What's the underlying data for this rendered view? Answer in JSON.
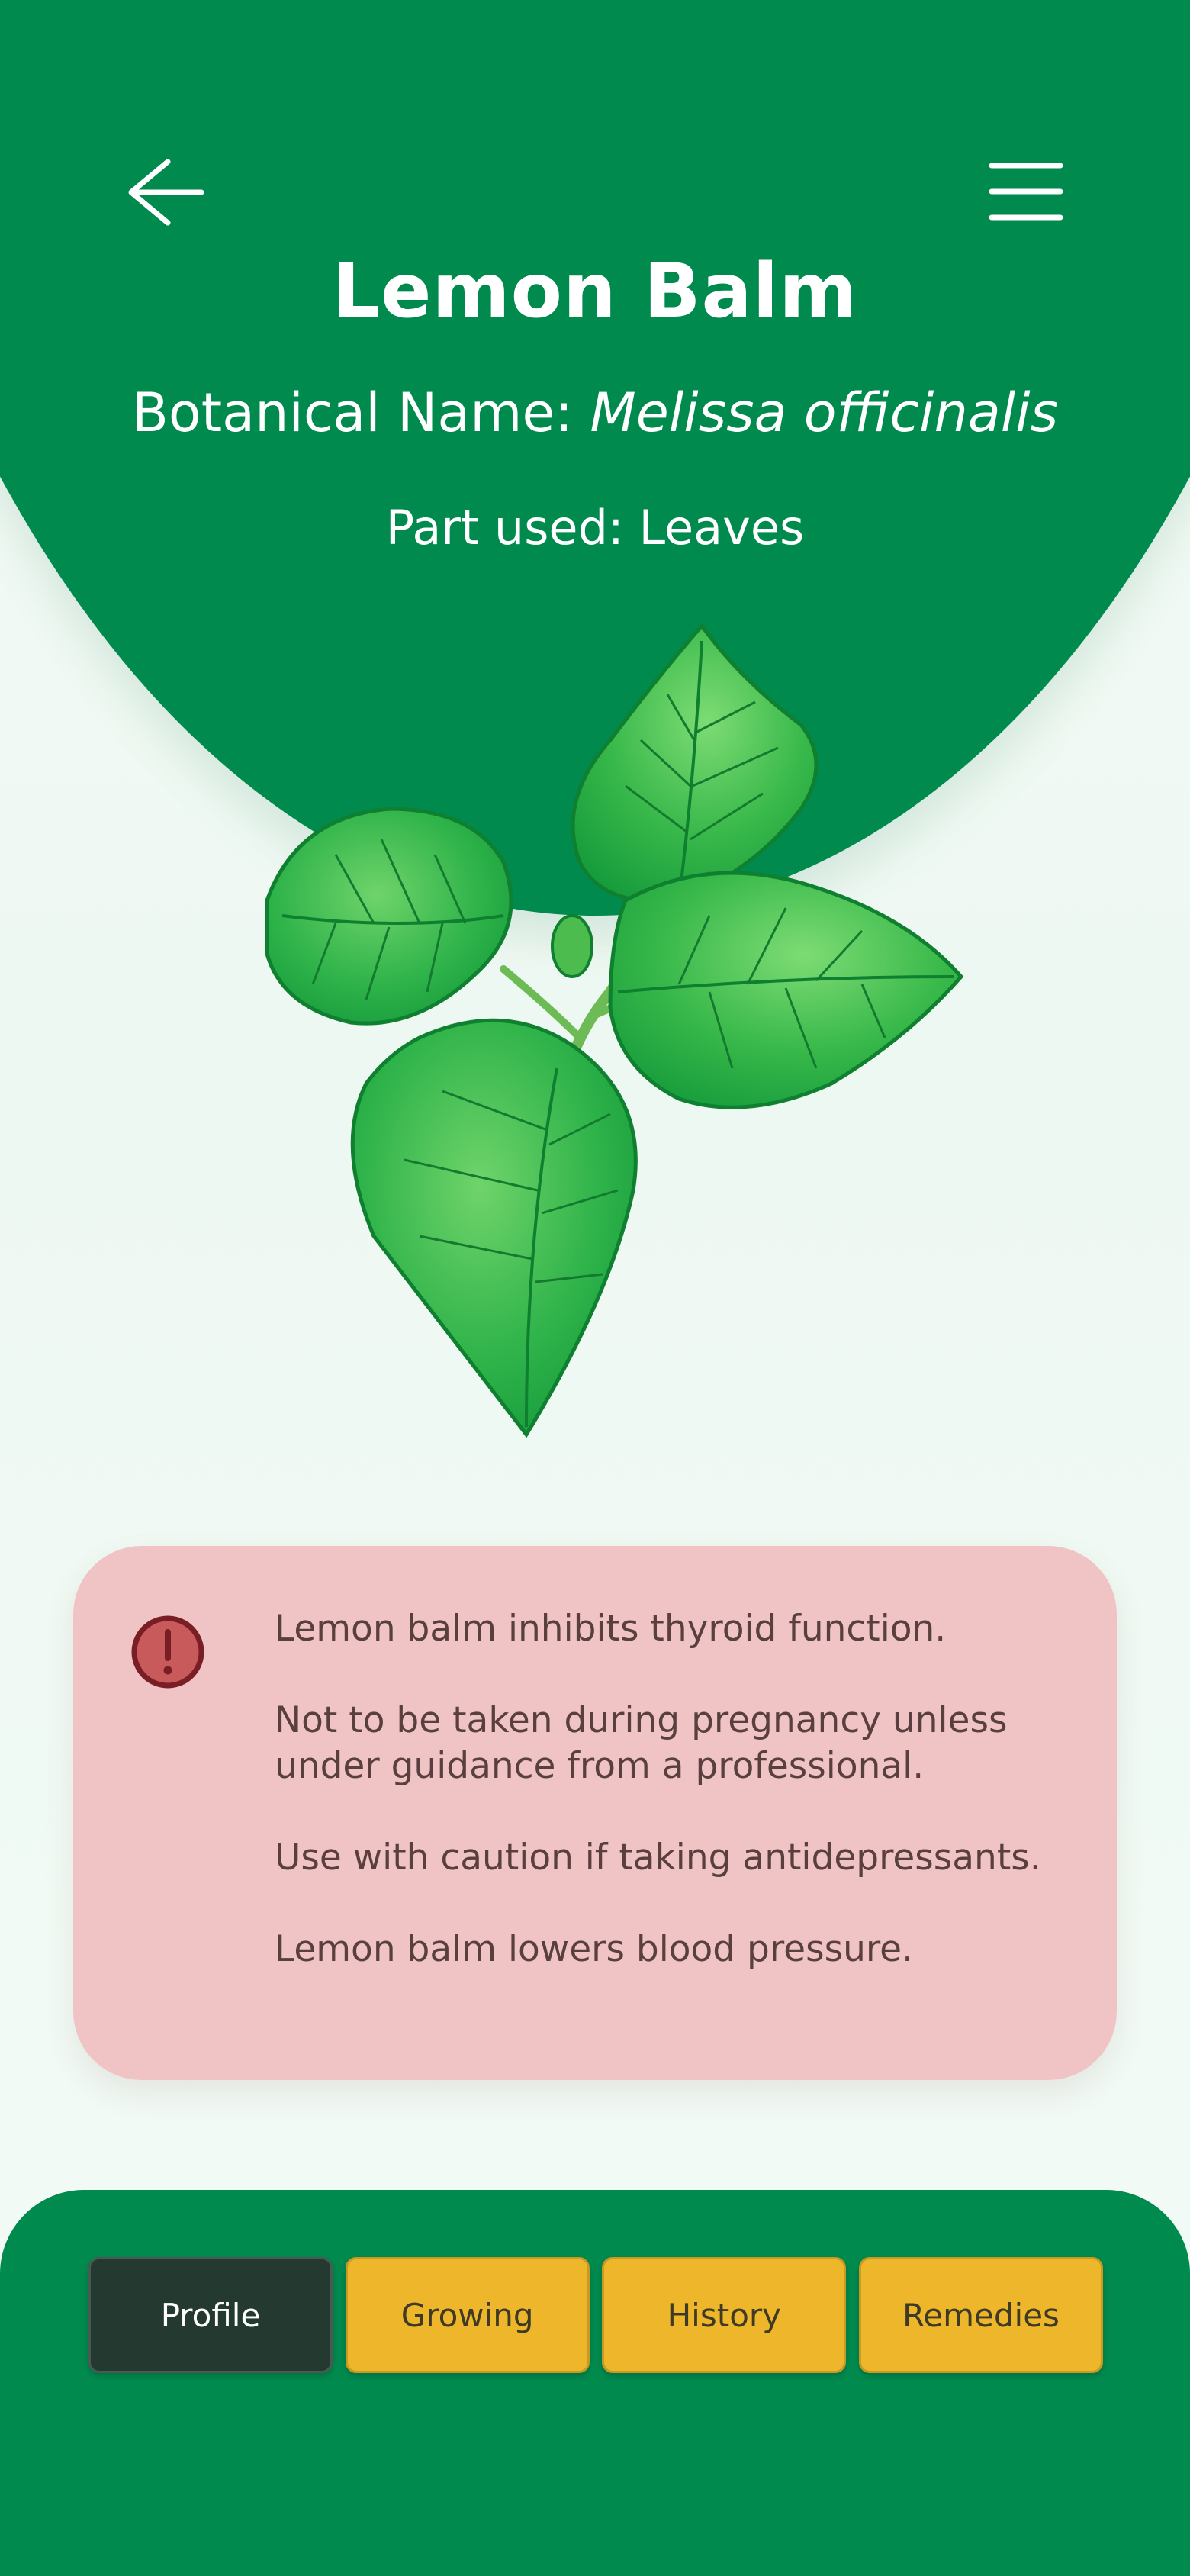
{
  "header": {
    "title": "Lemon Balm",
    "botanical_label": "Botanical Name: ",
    "botanical_latin": "Melissa officinalis",
    "part_used": "Part used: Leaves",
    "back_icon": "arrow-left-icon",
    "menu_icon": "hamburger-menu-icon"
  },
  "image": {
    "icon": "lemon-balm-plant-illustration"
  },
  "warning": {
    "icon": "alert-exclamation-icon",
    "items": [
      "Lemon balm inhibits thyroid function.",
      "Not to be taken during pregnancy unless under guidance from a professional.",
      "Use with caution if taking antidepressants.",
      "Lemon balm lowers blood pressure."
    ]
  },
  "tabs": [
    {
      "label": "Profile",
      "active": true
    },
    {
      "label": "Growing",
      "active": false
    },
    {
      "label": "History",
      "active": false
    },
    {
      "label": "Remedies",
      "active": false
    }
  ],
  "colors": {
    "primary_green": "#008a4e",
    "background": "#eff8f2",
    "warning_bg": "#f0c4c5",
    "tab_active": "#243a31",
    "tab_inactive": "#edb62b"
  }
}
